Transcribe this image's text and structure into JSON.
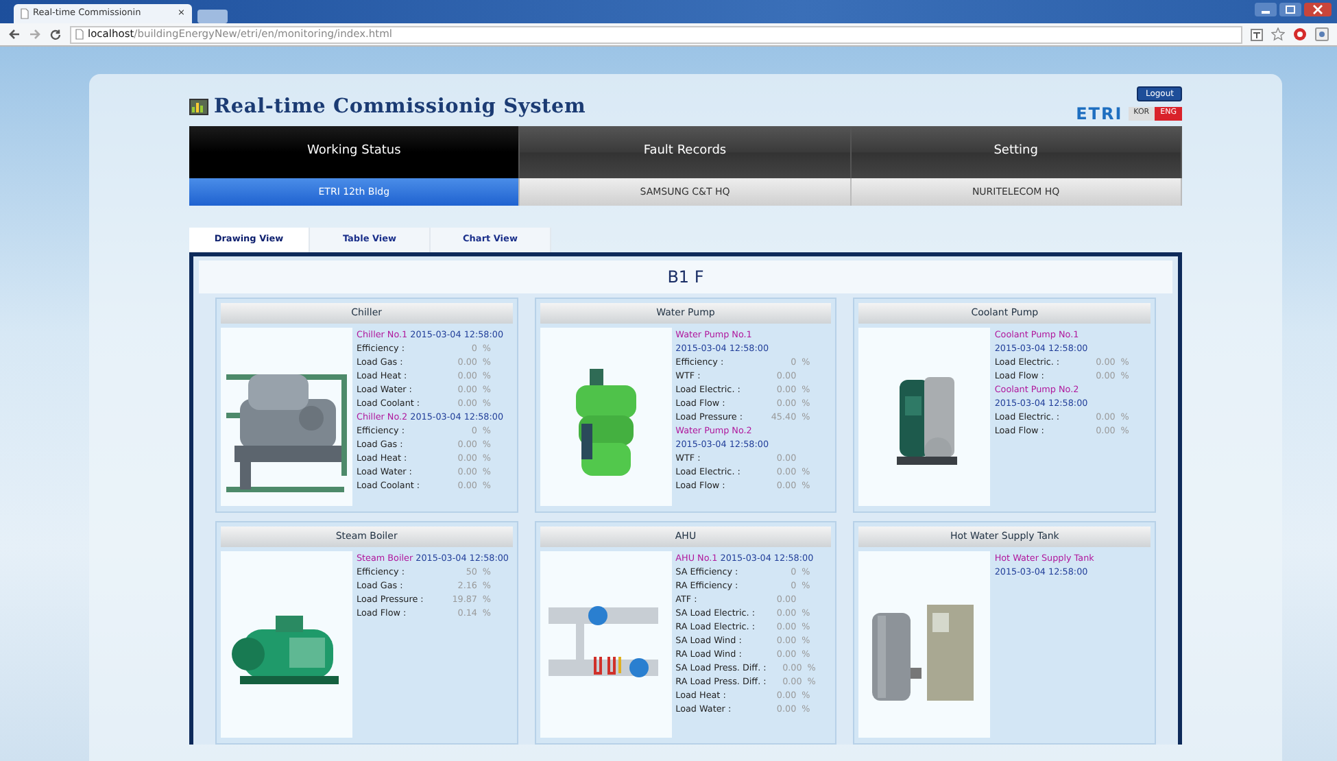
{
  "browser": {
    "tab_title": "Real-time Commissionin",
    "tab_close": "×",
    "url_host": "localhost",
    "url_path": "/buildingEnergyNew/etri/en/monitoring/index.html"
  },
  "header": {
    "title": "Real-time Commissionig System",
    "logo": "ETRI",
    "logout": "Logout",
    "languages": [
      {
        "label": "KOR",
        "selected": false
      },
      {
        "label": "ENG",
        "selected": true
      }
    ]
  },
  "main_menu": [
    {
      "label": "Working Status",
      "selected": true
    },
    {
      "label": "Fault Records",
      "selected": false
    },
    {
      "label": "Setting",
      "selected": false
    }
  ],
  "buildings": [
    {
      "label": "ETRI 12th Bldg",
      "selected": true
    },
    {
      "label": "SAMSUNG C&T HQ",
      "selected": false
    },
    {
      "label": "NURITELECOM HQ",
      "selected": false
    }
  ],
  "view_tabs": [
    {
      "label": "Drawing View",
      "selected": true
    },
    {
      "label": "Table View",
      "selected": false
    },
    {
      "label": "Chart View",
      "selected": false
    }
  ],
  "floor": "B1 F",
  "panels": [
    {
      "title": "Chiller",
      "lines": [
        {
          "kind": "device",
          "name": "Chiller No.1",
          "time": "2015-03-04 12:58:00"
        },
        {
          "kind": "metric",
          "label": "Efficiency :",
          "value": "0",
          "unit": "%"
        },
        {
          "kind": "metric",
          "label": "Load Gas :",
          "value": "0.00",
          "unit": "%"
        },
        {
          "kind": "metric",
          "label": "Load Heat :",
          "value": "0.00",
          "unit": "%"
        },
        {
          "kind": "metric",
          "label": "Load Water :",
          "value": "0.00",
          "unit": "%"
        },
        {
          "kind": "metric",
          "label": "Load Coolant :",
          "value": "0.00",
          "unit": "%"
        },
        {
          "kind": "device",
          "name": "Chiller No.2",
          "time": "2015-03-04 12:58:00"
        },
        {
          "kind": "metric",
          "label": "Efficiency :",
          "value": "0",
          "unit": "%"
        },
        {
          "kind": "metric",
          "label": "Load Gas :",
          "value": "0.00",
          "unit": "%"
        },
        {
          "kind": "metric",
          "label": "Load Heat :",
          "value": "0.00",
          "unit": "%"
        },
        {
          "kind": "metric",
          "label": "Load Water :",
          "value": "0.00",
          "unit": "%"
        },
        {
          "kind": "metric",
          "label": "Load Coolant :",
          "value": "0.00",
          "unit": "%"
        }
      ]
    },
    {
      "title": "Water Pump",
      "lines": [
        {
          "kind": "device",
          "name": "Water Pump No.1"
        },
        {
          "kind": "time",
          "time": "2015-03-04 12:58:00"
        },
        {
          "kind": "metric",
          "label": "Efficiency :",
          "value": "0",
          "unit": "%"
        },
        {
          "kind": "metric",
          "label": "WTF :",
          "value": "0.00"
        },
        {
          "kind": "metric",
          "label": "Load Electric. :",
          "value": "0.00",
          "unit": "%"
        },
        {
          "kind": "metric",
          "label": "Load Flow :",
          "value": "0.00",
          "unit": "%"
        },
        {
          "kind": "metric",
          "label": "Load Pressure :",
          "value": "45.40",
          "unit": "%"
        },
        {
          "kind": "device",
          "name": "Water Pump No.2"
        },
        {
          "kind": "time",
          "time": "2015-03-04 12:58:00"
        },
        {
          "kind": "metric",
          "label": "WTF :",
          "value": "0.00"
        },
        {
          "kind": "metric",
          "label": "Load Electric. :",
          "value": "0.00",
          "unit": "%"
        },
        {
          "kind": "metric",
          "label": "Load Flow :",
          "value": "0.00",
          "unit": "%"
        }
      ]
    },
    {
      "title": "Coolant Pump",
      "lines": [
        {
          "kind": "device",
          "name": "Coolant Pump No.1"
        },
        {
          "kind": "time",
          "time": "2015-03-04 12:58:00"
        },
        {
          "kind": "metric",
          "label": "Load Electric. :",
          "value": "0.00",
          "unit": "%"
        },
        {
          "kind": "metric",
          "label": "Load Flow :",
          "value": "0.00",
          "unit": "%"
        },
        {
          "kind": "device",
          "name": "Coolant Pump No.2"
        },
        {
          "kind": "time",
          "time": "2015-03-04 12:58:00"
        },
        {
          "kind": "metric",
          "label": "Load Electric. :",
          "value": "0.00",
          "unit": "%"
        },
        {
          "kind": "metric",
          "label": "Load Flow :",
          "value": "0.00",
          "unit": "%"
        }
      ]
    },
    {
      "title": "Steam Boiler",
      "lines": [
        {
          "kind": "device",
          "name": "Steam Boiler",
          "time": "2015-03-04 12:58:00"
        },
        {
          "kind": "metric",
          "label": "Efficiency :",
          "value": "50",
          "unit": "%"
        },
        {
          "kind": "metric",
          "label": "Load Gas :",
          "value": "2.16",
          "unit": "%"
        },
        {
          "kind": "metric",
          "label": "Load Pressure :",
          "value": "19.87",
          "unit": "%"
        },
        {
          "kind": "metric",
          "label": "Load Flow :",
          "value": "0.14",
          "unit": "%"
        }
      ]
    },
    {
      "title": "AHU",
      "lines": [
        {
          "kind": "device",
          "name": "AHU No.1",
          "time": "2015-03-04 12:58:00"
        },
        {
          "kind": "metric",
          "label": "SA Efficiency :",
          "value": "0",
          "unit": "%"
        },
        {
          "kind": "metric",
          "label": "RA Efficiency :",
          "value": "0",
          "unit": "%"
        },
        {
          "kind": "metric",
          "label": "ATF :",
          "value": "0.00"
        },
        {
          "kind": "metric",
          "label": "SA Load Electric. :",
          "value": "0.00",
          "unit": "%"
        },
        {
          "kind": "metric",
          "label": "RA Load Electric. :",
          "value": "0.00",
          "unit": "%"
        },
        {
          "kind": "metric",
          "label": "SA Load Wind :",
          "value": "0.00",
          "unit": "%"
        },
        {
          "kind": "metric",
          "label": "RA Load Wind :",
          "value": "0.00",
          "unit": "%"
        },
        {
          "kind": "metric",
          "label": "SA Load Press. Diff. :",
          "value": "0.00",
          "unit": "%"
        },
        {
          "kind": "metric",
          "label": "RA Load Press. Diff. :",
          "value": "0.00",
          "unit": "%"
        },
        {
          "kind": "metric",
          "label": "Load Heat :",
          "value": "0.00",
          "unit": "%"
        },
        {
          "kind": "metric",
          "label": "Load Water :",
          "value": "0.00",
          "unit": "%"
        }
      ]
    },
    {
      "title": "Hot Water Supply Tank",
      "lines": [
        {
          "kind": "device",
          "name": "Hot Water Supply Tank"
        },
        {
          "kind": "time",
          "time": "2015-03-04 12:58:00"
        }
      ]
    }
  ]
}
